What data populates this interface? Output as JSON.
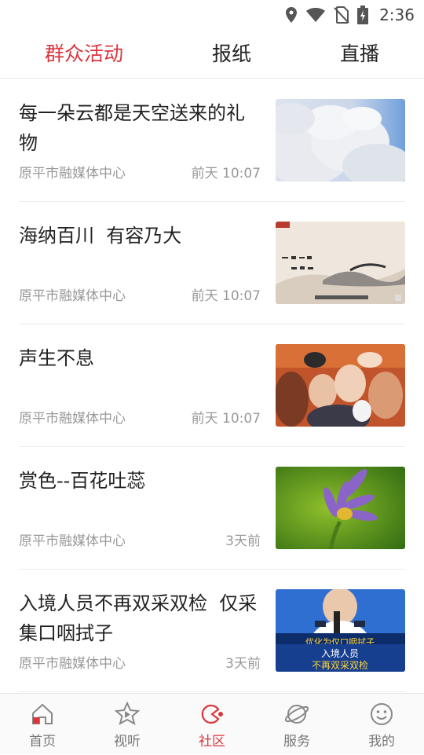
{
  "status_bar": {
    "time": "2:36",
    "icons": [
      "location-icon",
      "wifi-icon",
      "no-sim-icon",
      "battery-charging-icon"
    ]
  },
  "tabs": [
    {
      "label": "群众活动",
      "active": true
    },
    {
      "label": "报纸",
      "active": false
    },
    {
      "label": "直播",
      "active": false
    }
  ],
  "feed": [
    {
      "title": "每一朵云都是天空送来的礼物",
      "source": "原平市融媒体中心",
      "time": "前天 10:07",
      "thumb": "clouds-photo"
    },
    {
      "title": "海纳百川  有容乃大",
      "source": "原平市融媒体中心",
      "time": "前天 10:07",
      "thumb": "calligraphy-landscape-video-still"
    },
    {
      "title": "声生不息",
      "source": "原平市融媒体中心",
      "time": "前天 10:07",
      "thumb": "crowd-photo"
    },
    {
      "title": "赏色--百花吐蕊",
      "source": "原平市融媒体中心",
      "time": "3天前",
      "thumb": "water-lily-photo"
    },
    {
      "title": "入境人员不再双采双检  仅采集口咽拭子",
      "source": "原平市融媒体中心",
      "time": "3天前",
      "thumb": "press-conference-video-still"
    }
  ],
  "thumb_text": {
    "caption_yellow": "优化为仅口咽拭子",
    "caption_box1": "入境人员",
    "caption_box2": "不再双采双检"
  },
  "bottom_nav": [
    {
      "label": "首页",
      "icon": "home-icon",
      "active": false
    },
    {
      "label": "视听",
      "icon": "play-star-icon",
      "active": false
    },
    {
      "label": "社区",
      "icon": "community-icon",
      "active": true
    },
    {
      "label": "服务",
      "icon": "planet-icon",
      "active": false
    },
    {
      "label": "我的",
      "icon": "smiley-icon",
      "active": false
    }
  ],
  "colors": {
    "accent": "#d9363e",
    "text": "#222222",
    "muted": "#999999"
  }
}
